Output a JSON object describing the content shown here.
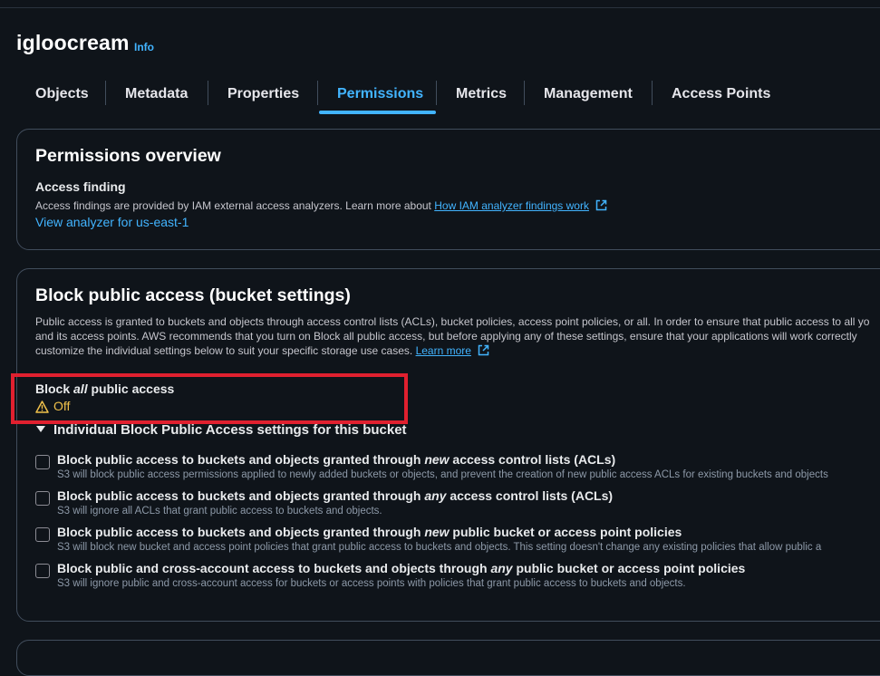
{
  "bucket": {
    "name": "igloocream",
    "info_label": "Info"
  },
  "tabs": [
    {
      "label": "Objects"
    },
    {
      "label": "Metadata"
    },
    {
      "label": "Properties"
    },
    {
      "label": "Permissions",
      "active": true
    },
    {
      "label": "Metrics"
    },
    {
      "label": "Management"
    },
    {
      "label": "Access Points"
    }
  ],
  "permissions_overview": {
    "title": "Permissions overview",
    "access_finding_label": "Access finding",
    "description": "Access findings are provided by IAM external access analyzers. Learn more about",
    "description_link": "How IAM analyzer findings work",
    "analyzer_link": "View analyzer for us-east-1"
  },
  "block_public_access": {
    "title": "Block public access (bucket settings)",
    "description_lines": [
      "Public access is granted to buckets and objects through access control lists (ACLs), bucket policies, access point policies, or all. In order to ensure that public access to all yo",
      "and its access points. AWS recommends that you turn on Block all public access, but before applying any of these settings, ensure that your applications will work correctly",
      "customize the individual settings below to suit your specific storage use cases."
    ],
    "learn_more": "Learn more",
    "block_all": {
      "pre": "Block ",
      "em": "all",
      "post": " public access",
      "status": "Off"
    },
    "individual_header": "Individual Block Public Access settings for this bucket",
    "settings": [
      {
        "pre": "Block public access to buckets and objects granted through ",
        "em": "new",
        "post": " access control lists (ACLs)",
        "desc": "S3 will block public access permissions applied to newly added buckets or objects, and prevent the creation of new public access ACLs for existing buckets and objects"
      },
      {
        "pre": "Block public access to buckets and objects granted through ",
        "em": "any",
        "post": " access control lists (ACLs)",
        "desc": "S3 will ignore all ACLs that grant public access to buckets and objects."
      },
      {
        "pre": "Block public access to buckets and objects granted through ",
        "em": "new",
        "post": " public bucket or access point policies",
        "desc": "S3 will block new bucket and access point policies that grant public access to buckets and objects. This setting doesn't change any existing policies that allow public a"
      },
      {
        "pre": "Block public and cross-account access to buckets and objects through ",
        "em": "any",
        "post": " public bucket or access point policies",
        "desc": "S3 will ignore public and cross-account access for buckets or access points with policies that grant public access to buckets and objects."
      }
    ]
  },
  "colors": {
    "accent": "#42b4ff",
    "warning": "#f0c14b",
    "highlight_box": "#e0202f",
    "background": "#0f141a"
  }
}
